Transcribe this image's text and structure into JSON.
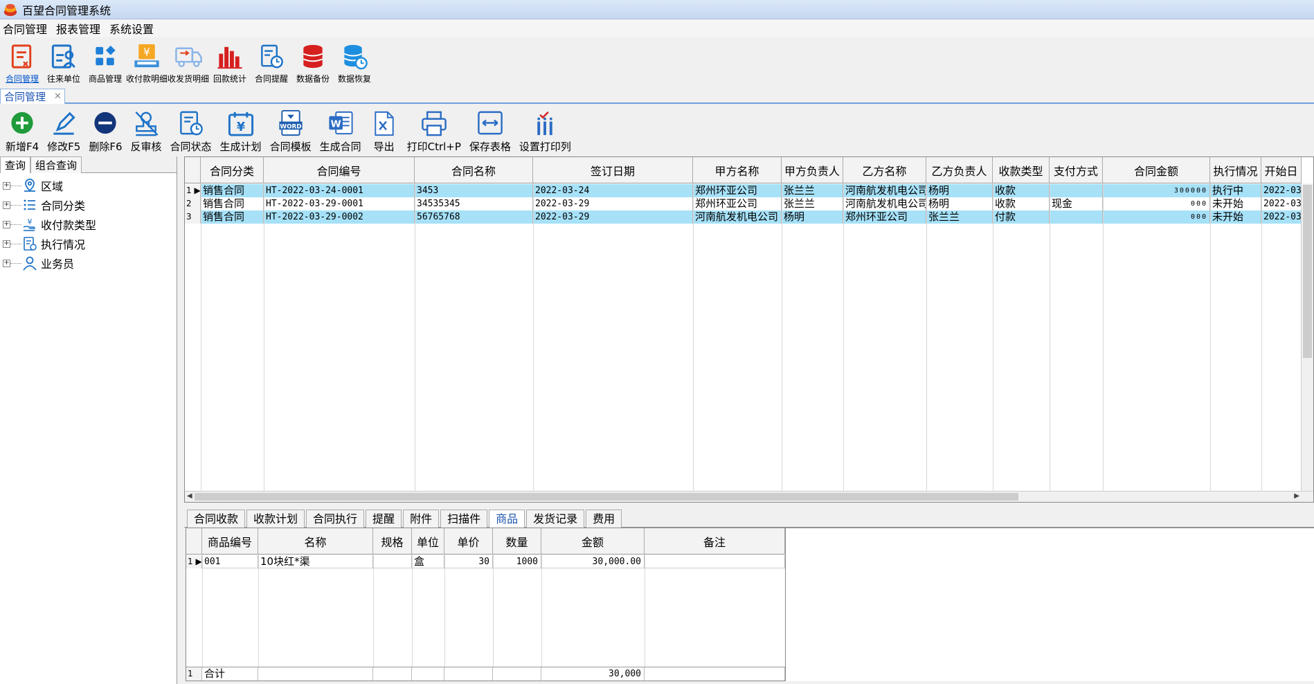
{
  "window": {
    "title": "百望合同管理系统"
  },
  "menu": [
    "合同管理",
    "报表管理",
    "系统设置"
  ],
  "main_toolbar": [
    {
      "label": "合同管理",
      "icon": "contract-icon",
      "active": true
    },
    {
      "label": "往来单位",
      "icon": "partner-icon"
    },
    {
      "label": "商品管理",
      "icon": "product-icon"
    },
    {
      "label": "收付款明细",
      "icon": "payment-detail-icon"
    },
    {
      "label": "收发货明细",
      "icon": "delivery-truck-icon"
    },
    {
      "label": "回款统计",
      "icon": "bar-chart-icon"
    },
    {
      "label": "合同提醒",
      "icon": "reminder-clock-icon"
    },
    {
      "label": "数据备份",
      "icon": "database-backup-icon"
    },
    {
      "label": "数据恢复",
      "icon": "database-restore-icon"
    }
  ],
  "doc_tab": {
    "label": "合同管理",
    "close": "✕"
  },
  "sub_toolbar": [
    {
      "label": "新增F4",
      "icon": "add-circle-icon"
    },
    {
      "label": "修改F5",
      "icon": "pencil-icon"
    },
    {
      "label": "删除F6",
      "icon": "minus-circle-icon"
    },
    {
      "label": "反审核",
      "icon": "unaudit-stamp-icon"
    },
    {
      "label": "合同状态",
      "icon": "contract-status-icon"
    },
    {
      "label": "生成计划",
      "icon": "plan-calendar-icon"
    },
    {
      "label": "合同模板",
      "icon": "word-template-icon"
    },
    {
      "label": "生成合同",
      "icon": "word-document-icon"
    },
    {
      "label": "导出",
      "icon": "export-excel-icon"
    },
    {
      "label": "打印Ctrl+P",
      "icon": "printer-icon"
    },
    {
      "label": "保存表格",
      "icon": "save-layout-icon"
    },
    {
      "label": "设置打印列",
      "icon": "print-columns-icon"
    }
  ],
  "left_tabs": [
    "查询",
    "组合查询"
  ],
  "tree": [
    {
      "label": "区域",
      "icon": "location-icon"
    },
    {
      "label": "合同分类",
      "icon": "list-icon"
    },
    {
      "label": "收付款类型",
      "icon": "money-hand-icon"
    },
    {
      "label": "执行情况",
      "icon": "execution-doc-icon"
    },
    {
      "label": "业务员",
      "icon": "user-icon"
    }
  ],
  "contracts": {
    "columns": [
      "合同分类",
      "合同编号",
      "合同名称",
      "签订日期",
      "甲方名称",
      "甲方负责人",
      "乙方名称",
      "乙方负责人",
      "收款类型",
      "支付方式",
      "合同金额",
      "执行情况",
      "开始日"
    ],
    "rows": [
      {
        "num": "1",
        "cells": [
          "销售合同",
          "HT-2022-03-24-0001",
          "3453",
          "2022-03-24",
          "郑州环亚公司",
          "张兰兰",
          "河南航发机电公司",
          "杨明",
          "收款",
          "",
          "300000",
          "执行中",
          "2022-03"
        ]
      },
      {
        "num": "2",
        "cells": [
          "销售合同",
          "HT-2022-03-29-0001",
          "34535345",
          "2022-03-29",
          "郑州环亚公司",
          "张兰兰",
          "河南航发机电公司",
          "杨明",
          "收款",
          "现金",
          "000",
          "未开始",
          "2022-03"
        ]
      },
      {
        "num": "3",
        "cells": [
          "销售合同",
          "HT-2022-03-29-0002",
          "56765768",
          "2022-03-29",
          "河南航发机电公司",
          "杨明",
          "郑州环亚公司",
          "张兰兰",
          "付款",
          "",
          "000",
          "未开始",
          "2022-03"
        ]
      }
    ]
  },
  "bottom_tabs": [
    "合同收款",
    "收款计划",
    "合同执行",
    "提醒",
    "附件",
    "扫描件",
    "商品",
    "发货记录",
    "费用"
  ],
  "bottom_active_tab": "商品",
  "products": {
    "columns": [
      "商品编号",
      "名称",
      "规格",
      "单位",
      "单价",
      "数量",
      "金额",
      "备注"
    ],
    "rows": [
      {
        "num": "1",
        "cells": [
          "001",
          "10块红*渠",
          "",
          "盒",
          "30",
          "1000",
          "30,000.00",
          ""
        ]
      }
    ],
    "total": {
      "num": "1",
      "label": "合计",
      "amount": "30,000"
    }
  }
}
